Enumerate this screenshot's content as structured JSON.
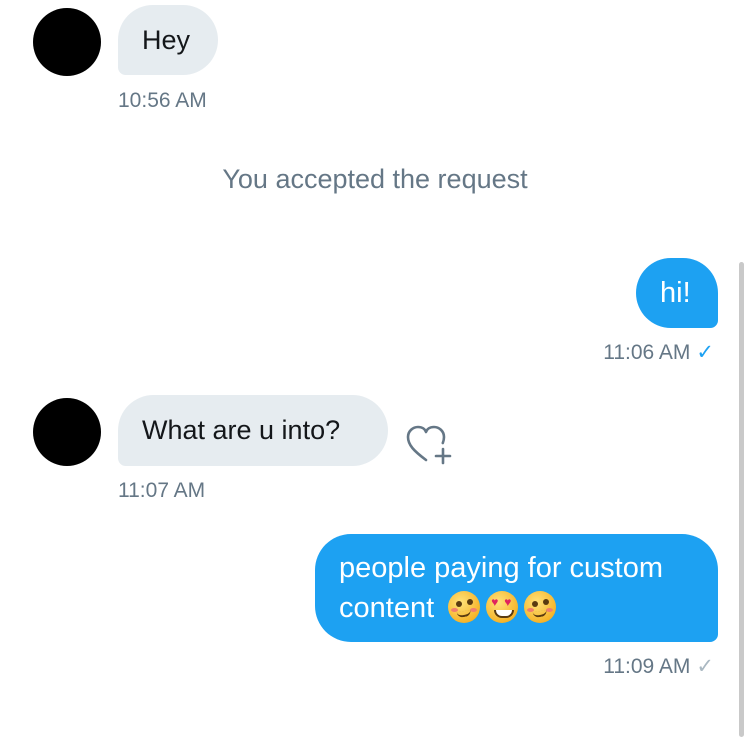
{
  "messages": [
    {
      "id": "m1",
      "direction": "incoming",
      "text": "Hey",
      "time": "10:56 AM"
    },
    {
      "id": "m2",
      "direction": "outgoing",
      "text": "hi!",
      "time": "11:06 AM",
      "status": "seen"
    },
    {
      "id": "m3",
      "direction": "incoming",
      "text": "What are u into?",
      "time": "11:07 AM"
    },
    {
      "id": "m4",
      "direction": "outgoing",
      "text_line1": "people paying for custom",
      "text_line2": "content",
      "time": "11:09 AM",
      "status": "sent",
      "emojis": [
        "woozy-face-emoji",
        "heart-eyes-emoji",
        "woozy-face-emoji"
      ]
    }
  ],
  "system_message": "You accepted the request",
  "colors": {
    "outgoing": "#1da1f2",
    "incoming": "#e6ecf0",
    "meta": "#657786",
    "seen_check": "#1da1f2",
    "sent_check": "#aab8c2"
  },
  "icons": {
    "check": "✓",
    "like": "heart-plus-icon"
  }
}
